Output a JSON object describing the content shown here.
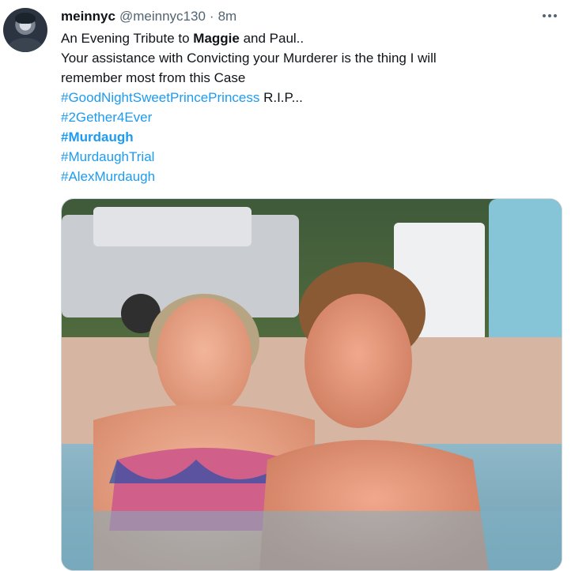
{
  "tweet": {
    "author_name": "meinnyc",
    "author_handle": "@meinnyc130",
    "separator": "·",
    "time": "8m",
    "line1_prefix": "An Evening Tribute to ",
    "line1_bold": "Maggie",
    "line1_suffix": " and Paul..",
    "line2": "Your assistance with Convicting your Murderer is the thing I will",
    "line3": "remember most from this Case",
    "hashtag1": "#GoodNightSweetPrincePrincess",
    "hashtag1_suffix": " R.I.P...",
    "hashtag2": "#2Gether4Ever",
    "hashtag3": "#Murdaugh",
    "hashtag4": "#MurdaughTrial",
    "hashtag5": "#AlexMurdaugh"
  },
  "icons": {
    "more": "more-horizontal-icon",
    "avatar": "avatar"
  },
  "colors": {
    "hashtag": "#1d9bf0",
    "secondary_text": "#536471",
    "primary_text": "#0f1419"
  }
}
